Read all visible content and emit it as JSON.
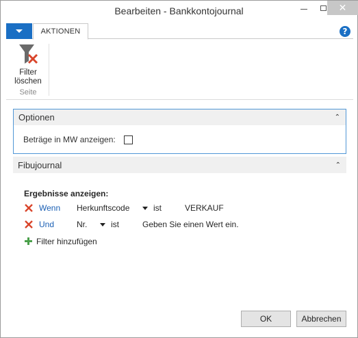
{
  "window": {
    "title": "Bearbeiten - Bankkontojournal"
  },
  "ribbon": {
    "tab_label": "AKTIONEN",
    "buttons": [
      {
        "label_line1": "Filter",
        "label_line2": "löschen",
        "icon": "clear-filter-icon"
      }
    ],
    "group_label": "Seite"
  },
  "optionen": {
    "header": "Optionen",
    "checkbox_label": "Beträge in MW anzeigen:",
    "checkbox_checked": false
  },
  "fibujournal": {
    "header": "Fibujournal",
    "results_title": "Ergebnisse anzeigen:",
    "filters": [
      {
        "keyword": "Wenn",
        "field": "Herkunftscode",
        "operator": "ist",
        "value": "VERKAUF"
      },
      {
        "keyword": "Und",
        "field": "Nr.",
        "operator": "ist",
        "value": "Geben Sie einen Wert ein."
      }
    ],
    "add_filter": "Filter hinzufügen"
  },
  "footer": {
    "ok": "OK",
    "cancel": "Abbrechen"
  },
  "colors": {
    "accent": "#1a6fc4",
    "remove_icon": "#d9452b",
    "add_icon": "#4aa04a",
    "section_border": "#4f96d6"
  }
}
